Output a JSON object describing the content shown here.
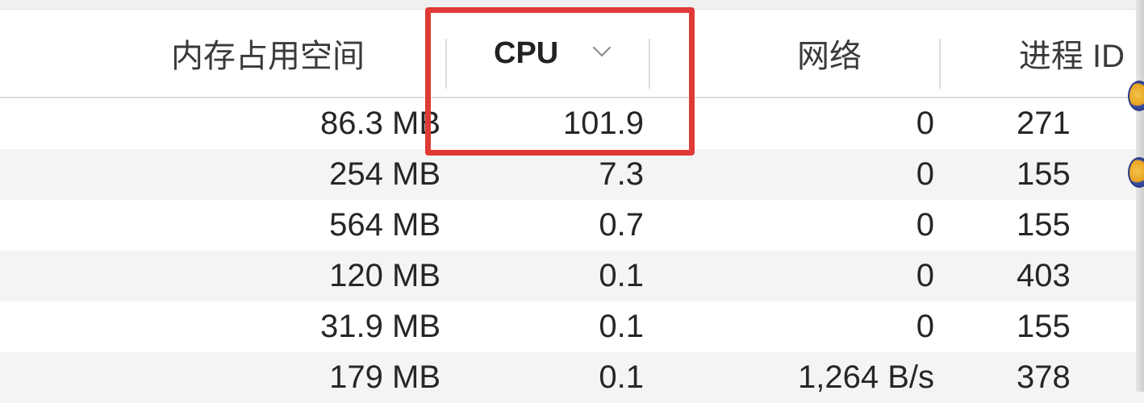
{
  "columns": {
    "memory": "内存占用空间",
    "cpu": "CPU",
    "network": "网络",
    "pid": "进程 ID"
  },
  "sort": {
    "column": "CPU",
    "direction": "descending",
    "indicator_icon": "chevron-down-icon"
  },
  "rows": [
    {
      "memory": "86.3 MB",
      "cpu": "101.9",
      "network": "0",
      "pid": "271"
    },
    {
      "memory": "254 MB",
      "cpu": "7.3",
      "network": "0",
      "pid": "155"
    },
    {
      "memory": "564 MB",
      "cpu": "0.7",
      "network": "0",
      "pid": "155"
    },
    {
      "memory": "120 MB",
      "cpu": "0.1",
      "network": "0",
      "pid": "403"
    },
    {
      "memory": "31.9 MB",
      "cpu": "0.1",
      "network": "0",
      "pid": "155"
    },
    {
      "memory": "179 MB",
      "cpu": "0.1",
      "network": "1,264 B/s",
      "pid": "378"
    }
  ],
  "colors": {
    "highlight": "#e03a36",
    "row_alt": "#f4f4f4",
    "header_text": "#3a3a3a"
  }
}
